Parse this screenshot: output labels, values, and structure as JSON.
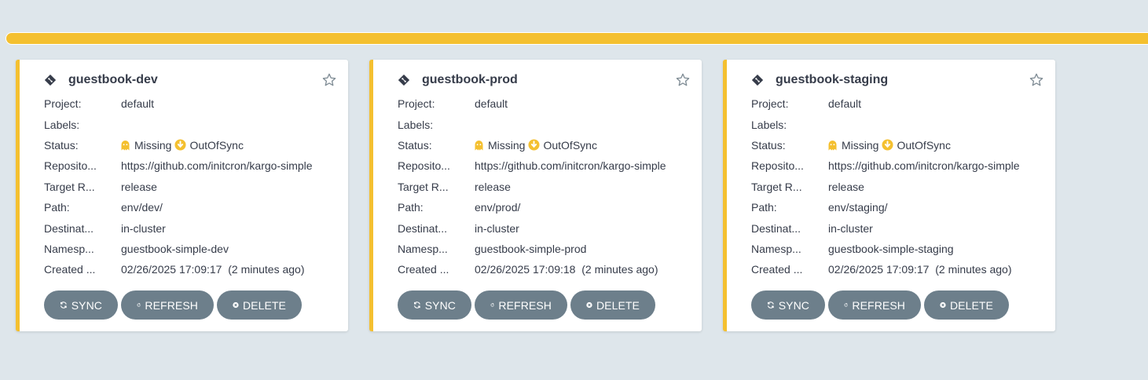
{
  "colors": {
    "accent": "#f4c030",
    "button_bg": "#6d7f8b",
    "background": "#dee6eb"
  },
  "labels": {
    "project": "Project:",
    "labels": "Labels:",
    "status": "Status:",
    "repository": "Reposito...",
    "target_revision": "Target R...",
    "path": "Path:",
    "destination": "Destinat...",
    "namespace": "Namesp...",
    "created": "Created ..."
  },
  "buttons": {
    "sync": "SYNC",
    "refresh": "REFRESH",
    "delete": "DELETE"
  },
  "apps": [
    {
      "name": "guestbook-dev",
      "project": "default",
      "labels": "",
      "health": "Missing",
      "sync": "OutOfSync",
      "repository": "https://github.com/initcron/kargo-simple",
      "target_revision": "release",
      "path": "env/dev/",
      "destination": "in-cluster",
      "namespace": "guestbook-simple-dev",
      "created": "02/26/2025 17:09:17  (2 minutes ago)"
    },
    {
      "name": "guestbook-prod",
      "project": "default",
      "labels": "",
      "health": "Missing",
      "sync": "OutOfSync",
      "repository": "https://github.com/initcron/kargo-simple",
      "target_revision": "release",
      "path": "env/prod/",
      "destination": "in-cluster",
      "namespace": "guestbook-simple-prod",
      "created": "02/26/2025 17:09:18  (2 minutes ago)"
    },
    {
      "name": "guestbook-staging",
      "project": "default",
      "labels": "",
      "health": "Missing",
      "sync": "OutOfSync",
      "repository": "https://github.com/initcron/kargo-simple",
      "target_revision": "release",
      "path": "env/staging/",
      "destination": "in-cluster",
      "namespace": "guestbook-simple-staging",
      "created": "02/26/2025 17:09:17  (2 minutes ago)"
    }
  ]
}
